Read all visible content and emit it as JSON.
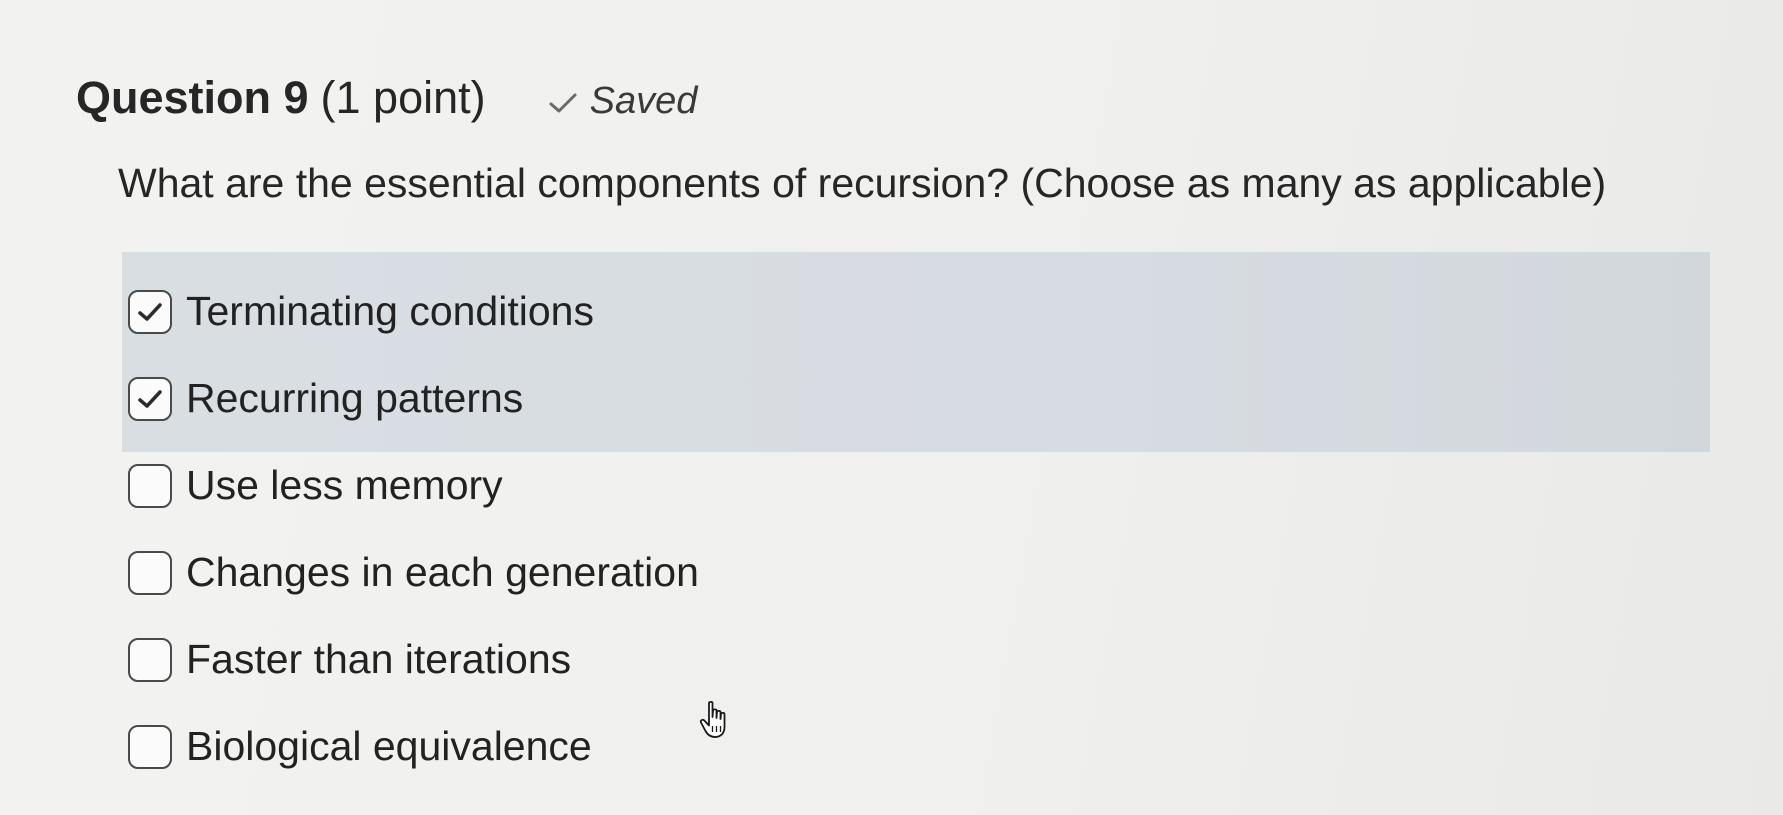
{
  "question": {
    "title": "Question 9",
    "points": "(1 point)",
    "status_label": "Saved",
    "status_icon": "checkmark-icon",
    "prompt": "What are the essential components of recursion? (Choose as many as applicable)"
  },
  "options": [
    {
      "label": "Terminating conditions",
      "checked": true
    },
    {
      "label": "Recurring patterns",
      "checked": true
    },
    {
      "label": "Use less memory",
      "checked": false
    },
    {
      "label": "Changes in each generation",
      "checked": false
    },
    {
      "label": "Faster than iterations",
      "checked": false
    },
    {
      "label": "Biological equivalence",
      "checked": false
    }
  ],
  "colors": {
    "selected_highlight": "#d9dee3",
    "checkbox_border": "#4a4a4a",
    "background": "#f0f0ee"
  },
  "cursor_icon": "hand-pointer-icon"
}
